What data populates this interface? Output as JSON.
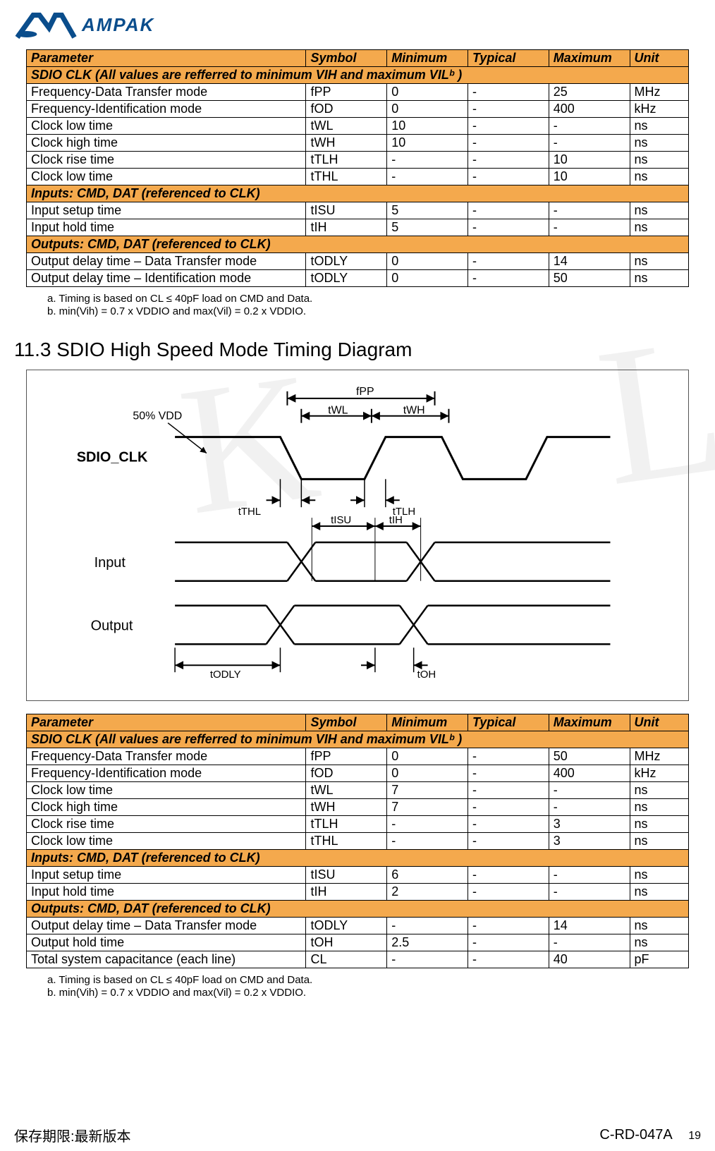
{
  "logo_text": "AMPAK",
  "table1": {
    "headers": [
      "Parameter",
      "Symbol",
      "Minimum",
      "Typical",
      "Maximum",
      "Unit"
    ],
    "section1": "SDIO CLK (All values are refferred to minimum VIH and maximum VILᵇ )",
    "rows1": [
      [
        "Frequency-Data Transfer mode",
        "fPP",
        "0",
        "-",
        "25",
        "MHz"
      ],
      [
        "Frequency-Identification mode",
        "fOD",
        "0",
        "-",
        "400",
        "kHz"
      ],
      [
        "Clock low time",
        "tWL",
        "10",
        "-",
        "-",
        "ns"
      ],
      [
        "Clock high time",
        "tWH",
        "10",
        "-",
        "-",
        "ns"
      ],
      [
        "Clock rise time",
        "tTLH",
        "-",
        "-",
        "10",
        "ns"
      ],
      [
        "Clock low time",
        "tTHL",
        "-",
        "-",
        "10",
        "ns"
      ]
    ],
    "section2": "Inputs: CMD, DAT (referenced to CLK)",
    "rows2": [
      [
        "Input setup time",
        "tISU",
        "5",
        "-",
        "-",
        "ns"
      ],
      [
        "Input hold time",
        "tIH",
        "5",
        "-",
        "-",
        "ns"
      ]
    ],
    "section3": "Outputs: CMD, DAT (referenced to CLK)",
    "rows3": [
      [
        "Output delay time – Data Transfer mode",
        "tODLY",
        "0",
        "-",
        "14",
        "ns"
      ],
      [
        "Output delay time – Identification mode",
        "tODLY",
        "0",
        "-",
        "50",
        "ns"
      ]
    ],
    "footnote_a": "a. Timing is based on CL ≤ 40pF load on CMD and Data.",
    "footnote_b": "b. min(Vih) = 0.7 x VDDIO and max(Vil) = 0.2 x VDDIO."
  },
  "heading": "11.3 SDIO High Speed Mode Timing Diagram",
  "diagram": {
    "clk_label": "SDIO_CLK",
    "vdd_label": "50% VDD",
    "input_label": "Input",
    "output_label": "Output",
    "fpp": "fPP",
    "twl": "tWL",
    "twh": "tWH",
    "tthl": "tTHL",
    "ttlh": "tTLH",
    "tisu": "tISU",
    "tih": "tIH",
    "todly": "tODLY",
    "toh": "tOH"
  },
  "table2": {
    "headers": [
      "Parameter",
      "Symbol",
      "Minimum",
      "Typical",
      "Maximum",
      "Unit"
    ],
    "section1": "SDIO CLK (All values are refferred to minimum VIH and maximum VILᵇ )",
    "rows1": [
      [
        "Frequency-Data Transfer mode",
        "fPP",
        "0",
        "-",
        "50",
        "MHz"
      ],
      [
        "Frequency-Identification mode",
        "fOD",
        "0",
        "-",
        "400",
        "kHz"
      ],
      [
        "Clock low time",
        "tWL",
        "7",
        "-",
        "-",
        "ns"
      ],
      [
        "Clock high time",
        "tWH",
        "7",
        "-",
        "-",
        "ns"
      ],
      [
        "Clock rise time",
        "tTLH",
        "-",
        "-",
        "3",
        "ns"
      ],
      [
        "Clock low time",
        "tTHL",
        "-",
        "-",
        "3",
        "ns"
      ]
    ],
    "section2": "Inputs: CMD, DAT (referenced to CLK)",
    "rows2": [
      [
        "Input setup time",
        "tISU",
        "6",
        "-",
        "-",
        "ns"
      ],
      [
        "Input hold time",
        "tIH",
        "2",
        "-",
        "-",
        "ns"
      ]
    ],
    "section3": "Outputs: CMD, DAT (referenced to CLK)",
    "rows3": [
      [
        "Output delay time – Data Transfer mode",
        "tODLY",
        "-",
        "-",
        "14",
        "ns"
      ],
      [
        "Output hold time",
        "tOH",
        "2.5",
        "-",
        "-",
        "ns"
      ],
      [
        "Total system capacitance (each line)",
        "CL",
        "-",
        "-",
        "40",
        "pF"
      ]
    ],
    "footnote_a": "a. Timing is based on CL ≤ 40pF load on CMD and Data.",
    "footnote_b": "b. min(Vih) = 0.7 x VDDIO and max(Vil) = 0.2 x VDDIO."
  },
  "footer": {
    "left": "保存期限:最新版本",
    "doc": "C-RD-047A",
    "page": "19"
  }
}
